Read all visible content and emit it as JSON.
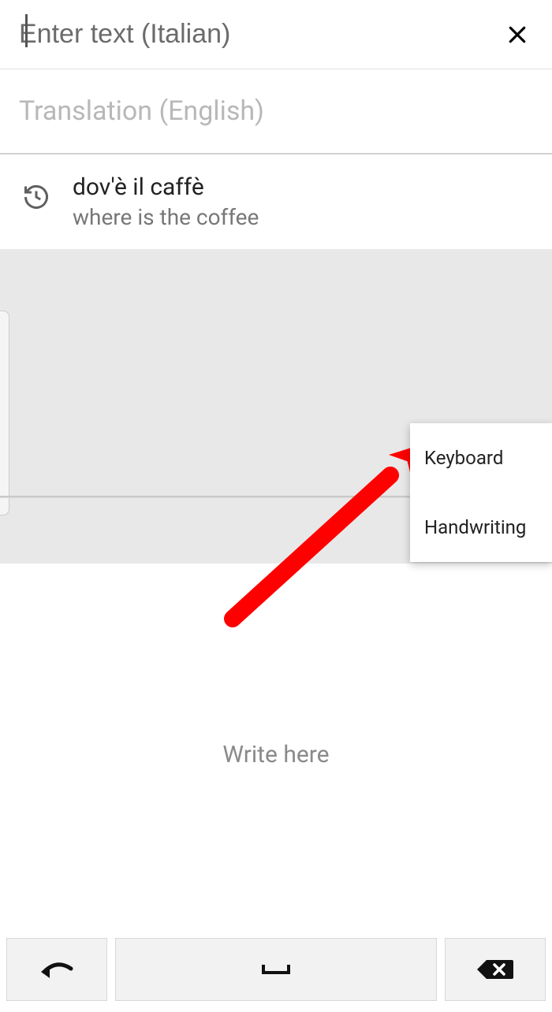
{
  "input": {
    "placeholder": "Enter text (Italian)",
    "value": ""
  },
  "translation": {
    "placeholder": "Translation (English)"
  },
  "history": {
    "items": [
      {
        "source": "dov'è il caffè",
        "target": "where is the coffee"
      }
    ]
  },
  "popup": {
    "options": [
      {
        "label": "Keyboard"
      },
      {
        "label": "Handwriting"
      }
    ]
  },
  "handwriting": {
    "hint": "Write here"
  },
  "annotation": {
    "arrow_color": "#ff0000"
  }
}
